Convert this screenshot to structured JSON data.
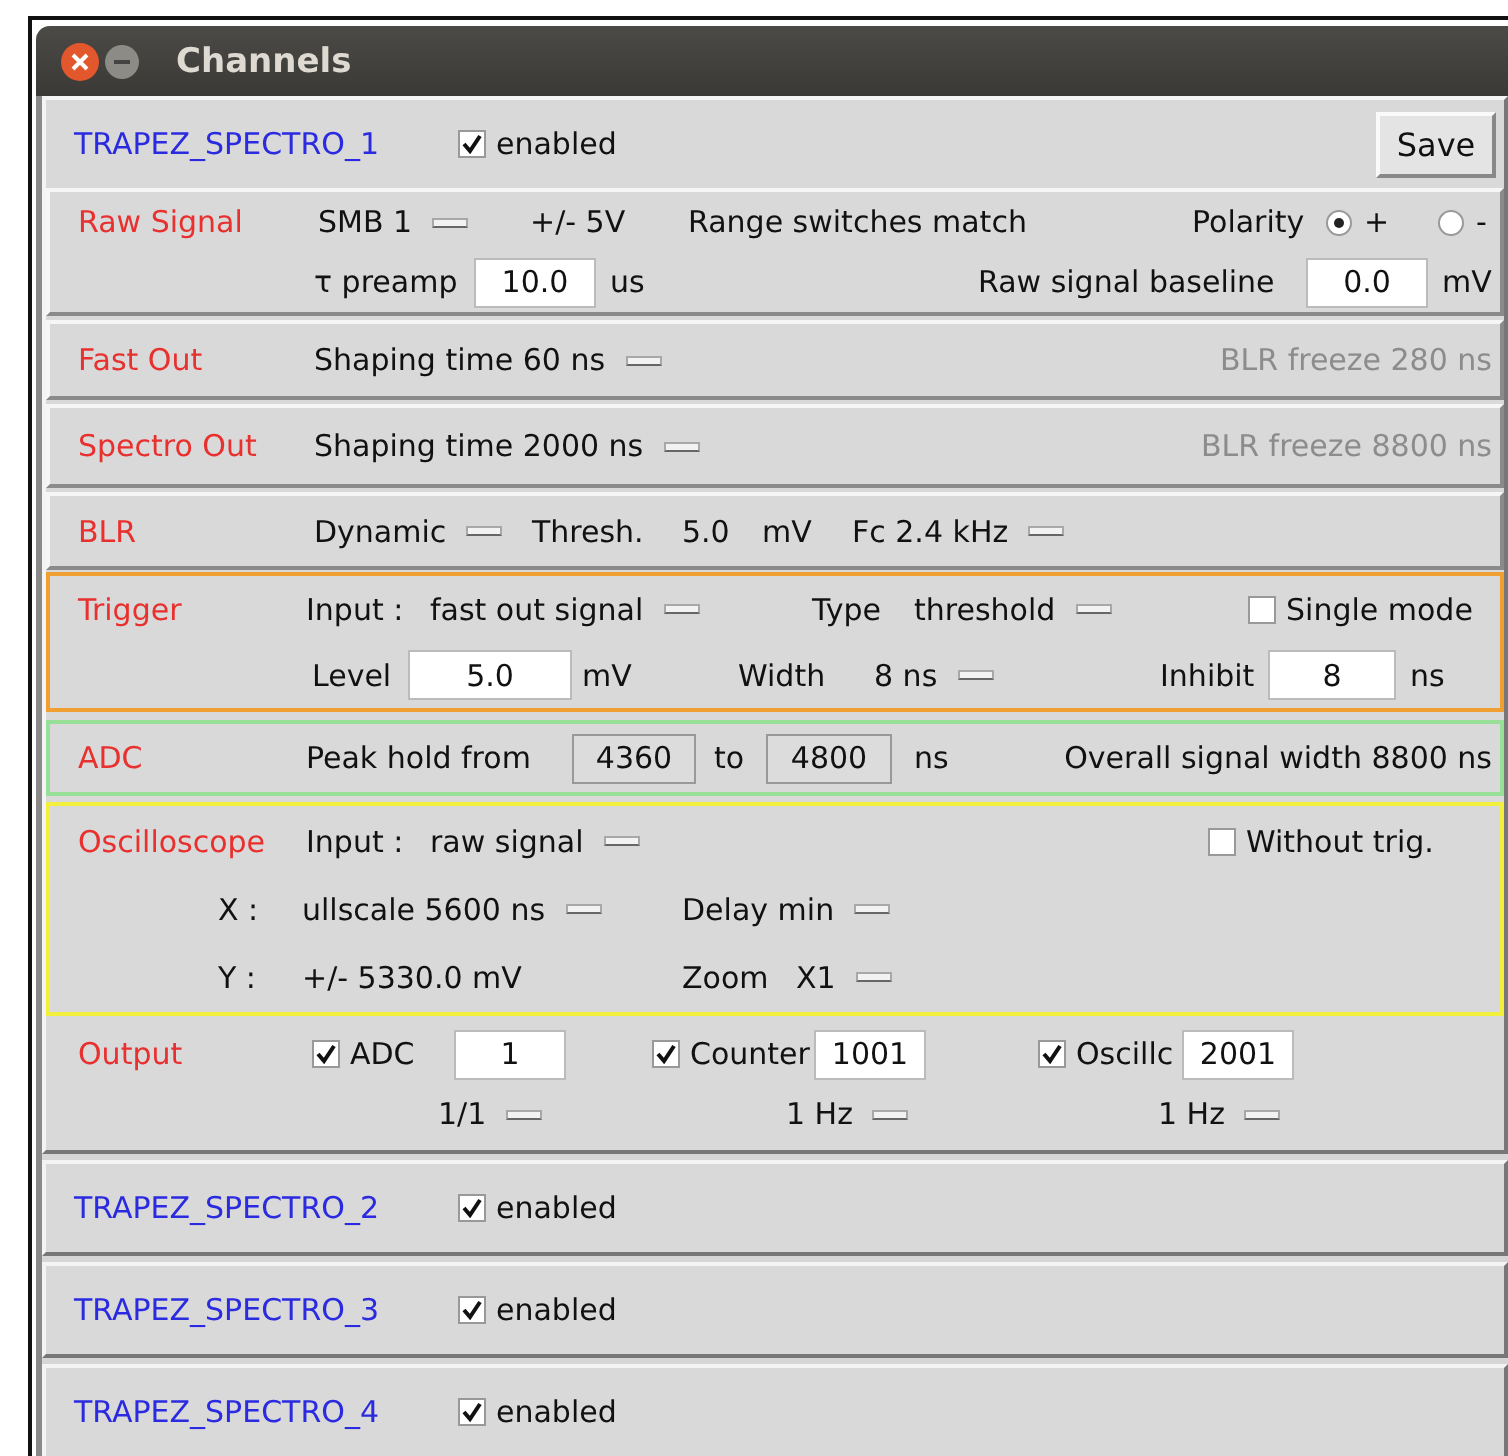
{
  "window": {
    "title": "Channels"
  },
  "channels": [
    {
      "name": "TRAPEZ_SPECTRO_1",
      "enabled": true,
      "enabled_label": "enabled",
      "save_button": "Save",
      "sections": [
        {
          "label": "Raw Signal",
          "kind": "raised",
          "lines": [
            {
              "items": [
                {
                  "kind": "menu",
                  "text": "SMB 1"
                },
                {
                  "kind": "text",
                  "text": "+/- 5V"
                },
                {
                  "kind": "text",
                  "text": "Range switches match"
                },
                {
                  "kind": "text",
                  "text": "Polarity"
                },
                {
                  "kind": "radio",
                  "text": "+",
                  "selected": true
                },
                {
                  "kind": "radio",
                  "text": "-",
                  "selected": false
                }
              ]
            },
            {
              "items": [
                {
                  "kind": "text",
                  "text": "τ preamp"
                },
                {
                  "kind": "field",
                  "value": "10.0"
                },
                {
                  "kind": "text",
                  "text": "us"
                },
                {
                  "kind": "text",
                  "text": "Raw signal baseline"
                },
                {
                  "kind": "field",
                  "value": "0.0"
                },
                {
                  "kind": "text",
                  "text": "mV"
                }
              ]
            }
          ]
        },
        {
          "label": "Fast Out",
          "kind": "raised",
          "lines": [
            {
              "items": [
                {
                  "kind": "menu",
                  "text": "Shaping time 60 ns"
                },
                {
                  "kind": "disabled_text",
                  "text": "BLR freeze 280 ns"
                }
              ]
            }
          ]
        },
        {
          "label": "Spectro Out",
          "kind": "raised",
          "lines": [
            {
              "items": [
                {
                  "kind": "menu",
                  "text": "Shaping time 2000 ns"
                },
                {
                  "kind": "disabled_text",
                  "text": "BLR freeze 8800 ns"
                }
              ]
            }
          ]
        },
        {
          "label": "BLR",
          "kind": "raised",
          "lines": [
            {
              "items": [
                {
                  "kind": "menu",
                  "text": "Dynamic"
                },
                {
                  "kind": "text",
                  "text": "Thresh."
                },
                {
                  "kind": "text",
                  "text": "5.0"
                },
                {
                  "kind": "text",
                  "text": "mV"
                },
                {
                  "kind": "menu",
                  "text": "Fc 2.4 kHz"
                }
              ]
            }
          ]
        },
        {
          "label": "Trigger",
          "kind": "framed",
          "color": "#f0a030",
          "lines": [
            {
              "items": [
                {
                  "kind": "text",
                  "text": "Input :"
                },
                {
                  "kind": "menu",
                  "text": "fast out signal"
                },
                {
                  "kind": "text",
                  "text": "Type"
                },
                {
                  "kind": "menu",
                  "text": "threshold"
                },
                {
                  "kind": "check",
                  "text": "Single mode",
                  "checked": false
                }
              ]
            },
            {
              "items": [
                {
                  "kind": "text",
                  "text": "Level"
                },
                {
                  "kind": "field",
                  "value": "5.0"
                },
                {
                  "kind": "text",
                  "text": "mV"
                },
                {
                  "kind": "text",
                  "text": "Width"
                },
                {
                  "kind": "menu",
                  "text": "8 ns"
                },
                {
                  "kind": "text",
                  "text": "Inhibit"
                },
                {
                  "kind": "field",
                  "value": "8"
                },
                {
                  "kind": "text",
                  "text": "ns"
                }
              ]
            }
          ]
        },
        {
          "label": "ADC",
          "kind": "framed",
          "color": "#98e098",
          "lines": [
            {
              "items": [
                {
                  "kind": "text",
                  "text": "Peak hold from"
                },
                {
                  "kind": "readonly_field",
                  "value": "4360"
                },
                {
                  "kind": "text",
                  "text": "to"
                },
                {
                  "kind": "readonly_field",
                  "value": "4800"
                },
                {
                  "kind": "text",
                  "text": "ns"
                },
                {
                  "kind": "text",
                  "text": "Overall signal width 8800 ns"
                }
              ]
            }
          ]
        },
        {
          "label": "Oscilloscope",
          "kind": "framed",
          "color": "#f2f03c",
          "lines": [
            {
              "items": [
                {
                  "kind": "text",
                  "text": "Input :"
                },
                {
                  "kind": "menu",
                  "text": "raw signal"
                },
                {
                  "kind": "check",
                  "text": "Without trig.",
                  "checked": false
                }
              ]
            },
            {
              "items": [
                {
                  "kind": "text",
                  "text": "X :"
                },
                {
                  "kind": "menu",
                  "text": "ullscale 5600 ns"
                },
                {
                  "kind": "menu",
                  "text": "Delay min"
                }
              ]
            },
            {
              "items": [
                {
                  "kind": "text",
                  "text": "Y :"
                },
                {
                  "kind": "text",
                  "text": "+/- 5330.0 mV"
                },
                {
                  "kind": "text",
                  "text": "Zoom"
                },
                {
                  "kind": "menu",
                  "text": "X1"
                }
              ]
            }
          ]
        },
        {
          "label": "Output",
          "kind": "plain",
          "lines": [
            {
              "items": [
                {
                  "kind": "check",
                  "text": "ADC",
                  "checked": true
                },
                {
                  "kind": "field",
                  "value": "1"
                },
                {
                  "kind": "check",
                  "text": "Counter",
                  "checked": true
                },
                {
                  "kind": "field",
                  "value": "1001"
                },
                {
                  "kind": "check",
                  "text": "Oscillc",
                  "checked": true
                },
                {
                  "kind": "field",
                  "value": "2001"
                }
              ]
            },
            {
              "items": [
                {
                  "kind": "menu",
                  "text": "1/1"
                },
                {
                  "kind": "menu",
                  "text": "1 Hz"
                },
                {
                  "kind": "menu",
                  "text": "1 Hz"
                }
              ]
            }
          ]
        }
      ]
    },
    {
      "name": "TRAPEZ_SPECTRO_2",
      "enabled": true,
      "enabled_label": "enabled"
    },
    {
      "name": "TRAPEZ_SPECTRO_3",
      "enabled": true,
      "enabled_label": "enabled"
    },
    {
      "name": "TRAPEZ_SPECTRO_4",
      "enabled": true,
      "enabled_label": "enabled"
    }
  ]
}
